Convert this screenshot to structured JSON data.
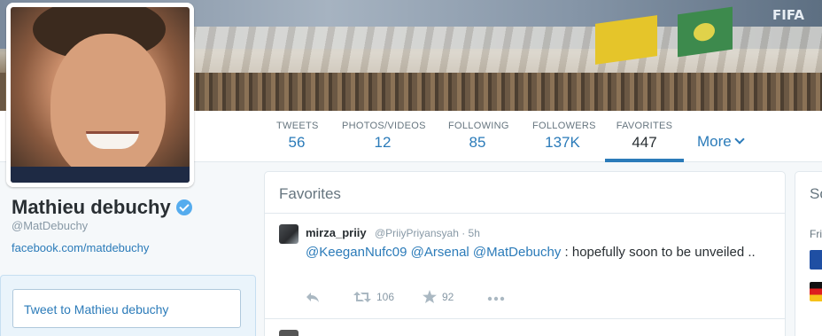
{
  "header": {
    "banner_text": "FIFA"
  },
  "profile": {
    "name": "Mathieu debuchy",
    "handle": "@MatDebuchy",
    "website": "facebook.com/matdebuchy",
    "verified": true,
    "tweet_to_label": "Tweet to Mathieu debuchy"
  },
  "nav": {
    "stats": [
      {
        "label": "TWEETS",
        "value": "56"
      },
      {
        "label": "PHOTOS/VIDEOS",
        "value": "12"
      },
      {
        "label": "FOLLOWING",
        "value": "85"
      },
      {
        "label": "FOLLOWERS",
        "value": "137K"
      },
      {
        "label": "FAVORITES",
        "value": "447"
      }
    ],
    "more_label": "More",
    "active_index": 4
  },
  "timeline": {
    "title": "Favorites",
    "tweets": [
      {
        "name": "mirza_priiy",
        "handle": "@PriiyPriyansyah",
        "time": "5h",
        "mention1": "@KeeganNufc09",
        "mention2": "@Arsenal",
        "mention3": "@MatDebuchy",
        "text_after": ": hopefully soon to be unveiled ..",
        "retweets": "106",
        "favorites": "92"
      }
    ]
  },
  "right_panel": {
    "title": "So",
    "subtitle": "Fri"
  },
  "colors": {
    "link": "#2b7bb9",
    "verified": "#55acee",
    "background": "#f5f8fa"
  }
}
